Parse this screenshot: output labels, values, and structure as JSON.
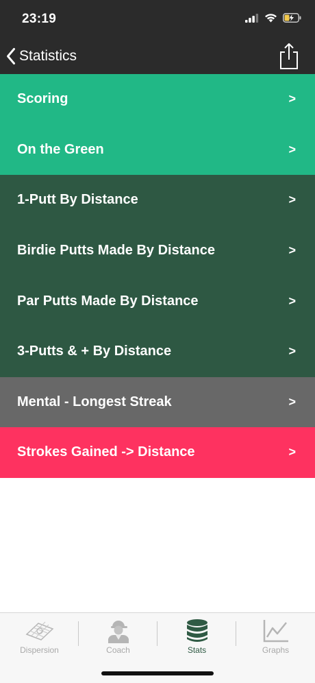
{
  "status": {
    "time": "23:19"
  },
  "nav": {
    "back_label": "Statistics"
  },
  "colors": {
    "header": "#2b2b2b",
    "green_light": "#21b886",
    "green_dark": "#2e5843",
    "gray": "#686868",
    "pink": "#fe3260"
  },
  "menu": {
    "items": [
      {
        "label": "Scoring",
        "chevron": ">",
        "color": "#21b886"
      },
      {
        "label": "On the Green",
        "chevron": ">",
        "color": "#21b886"
      },
      {
        "label": "1-Putt By Distance",
        "chevron": ">",
        "color": "#2e5843"
      },
      {
        "label": "Birdie Putts Made By Distance",
        "chevron": ">",
        "color": "#2e5843"
      },
      {
        "label": "Par Putts Made By Distance",
        "chevron": ">",
        "color": "#2e5843"
      },
      {
        "label": "3-Putts & + By Distance",
        "chevron": ">",
        "color": "#2e5843"
      },
      {
        "label": "Mental - Longest Streak",
        "chevron": ">",
        "color": "#686868"
      },
      {
        "label": "Strokes Gained -> Distance",
        "chevron": ">",
        "color": "#fe3260"
      }
    ]
  },
  "tabs": [
    {
      "label": "Dispersion",
      "icon": "dispersion-icon",
      "active": false
    },
    {
      "label": "Coach",
      "icon": "coach-icon",
      "active": false
    },
    {
      "label": "Stats",
      "icon": "stats-icon",
      "active": true
    },
    {
      "label": "Graphs",
      "icon": "graphs-icon",
      "active": false
    }
  ]
}
